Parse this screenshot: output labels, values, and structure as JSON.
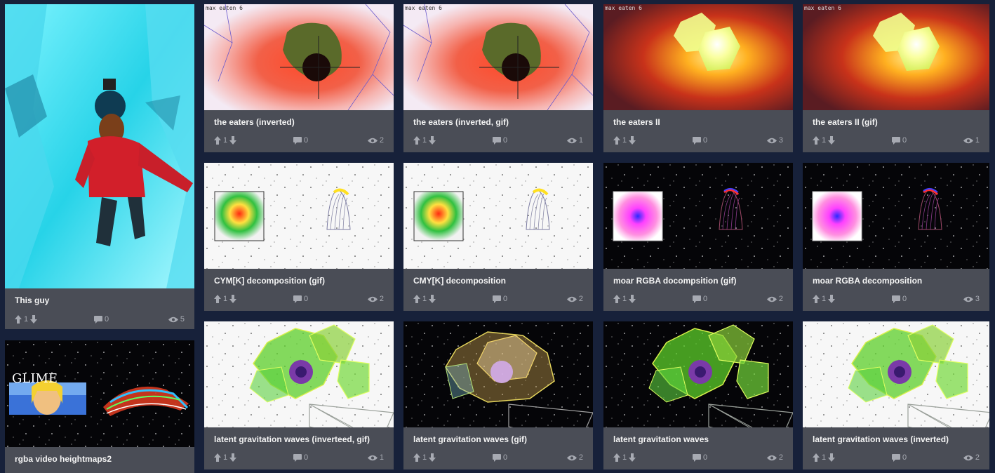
{
  "items": [
    {
      "title": "This guy",
      "up": "1",
      "comments": "0",
      "views": "5"
    },
    {
      "title": "rgba video heightmaps2"
    },
    {
      "title": "the eaters (inverted)",
      "up": "1",
      "comments": "0",
      "views": "2",
      "overlay": "max eaten 6"
    },
    {
      "title": "the eaters (inverted, gif)",
      "up": "1",
      "comments": "0",
      "views": "1",
      "overlay": "max eaten 6"
    },
    {
      "title": "the eaters II",
      "up": "1",
      "comments": "0",
      "views": "3",
      "overlay": "max eaten 6"
    },
    {
      "title": "the eaters II (gif)",
      "up": "1",
      "comments": "0",
      "views": "1",
      "overlay": "max eaten 6"
    },
    {
      "title": "CYM[K] decomposition (gif)",
      "up": "1",
      "comments": "0",
      "views": "2"
    },
    {
      "title": "CMY[K] decomposition",
      "up": "1",
      "comments": "0",
      "views": "2"
    },
    {
      "title": "moar RGBA docompsition (gif)",
      "up": "1",
      "comments": "0",
      "views": "2"
    },
    {
      "title": "moar RGBA decomposition",
      "up": "1",
      "comments": "0",
      "views": "3"
    },
    {
      "title": "latent gravitation waves (inverteed, gif)",
      "up": "1",
      "comments": "0",
      "views": "1"
    },
    {
      "title": "latent gravitation waves (gif)",
      "up": "1",
      "comments": "0",
      "views": "2"
    },
    {
      "title": "latent gravitation waves",
      "up": "1",
      "comments": "0",
      "views": "2"
    },
    {
      "title": "latent gravitation waves (inverted)",
      "up": "1",
      "comments": "0",
      "views": "2"
    }
  ],
  "thumb_text": {
    "glitch_word": "GLIME"
  },
  "colors": {
    "background": "#17213a",
    "card": "#4a4d56",
    "title": "#f4f4f4",
    "stats": "#a7aab2"
  }
}
